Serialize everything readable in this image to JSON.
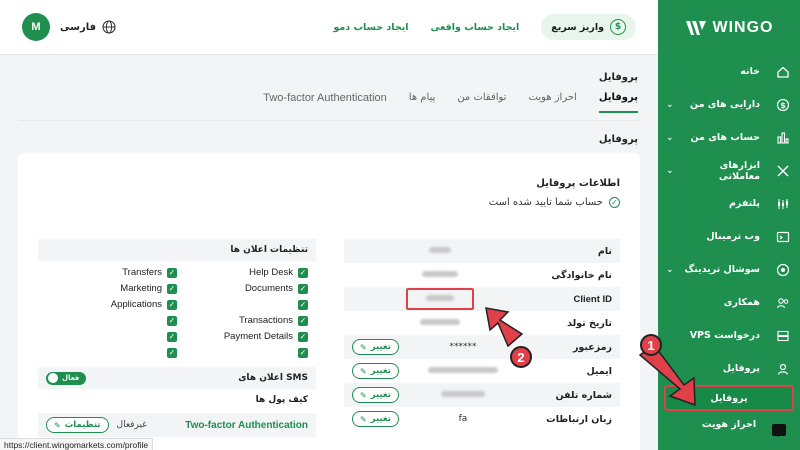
{
  "brand": {
    "name": "WINGO"
  },
  "topbar": {
    "avatar_letter": "M",
    "language": "فارسی",
    "demo_account": "ایجاد حساب دمو",
    "real_account": "ایجاد حساب واقعی",
    "quick_deposit": "واریز سریع"
  },
  "sidebar": {
    "items": [
      {
        "label": "خانه",
        "icon": "home-icon",
        "has_chevron": false
      },
      {
        "label": "دارایی های من",
        "icon": "dollar-circle-icon",
        "has_chevron": true
      },
      {
        "label": "حساب های من",
        "icon": "bar-chart-icon",
        "has_chevron": true
      },
      {
        "label": "ابزارهای معاملاتی",
        "icon": "tools-icon",
        "has_chevron": true
      },
      {
        "label": "پلتفرم",
        "icon": "candles-icon",
        "has_chevron": false
      },
      {
        "label": "وب ترمینال",
        "icon": "terminal-icon",
        "has_chevron": false
      },
      {
        "label": "سوشال تریدینگ",
        "icon": "social-icon",
        "has_chevron": true
      },
      {
        "label": "همکاری",
        "icon": "users-icon",
        "has_chevron": false
      },
      {
        "label": "درخواست VPS",
        "icon": "server-icon",
        "has_chevron": false
      },
      {
        "label": "پروفایل",
        "icon": "user-icon",
        "has_chevron": true
      }
    ],
    "sub_profile": "پروفایل",
    "sub_kyc": "احراز هویت"
  },
  "page": {
    "title": "پروفایل",
    "tabs": [
      {
        "label": "پروفایل",
        "active": true
      },
      {
        "label": "احراز هویت",
        "active": false
      },
      {
        "label": "توافقات من",
        "active": false
      },
      {
        "label": "پیام ها",
        "active": false
      },
      {
        "label": "Two-factor Authentication",
        "active": false
      }
    ],
    "section_title": "پروفایل"
  },
  "card": {
    "title": "اطلاعات پروفایل",
    "verified_text": "حساب شما تایید شده است"
  },
  "info": {
    "rows": [
      {
        "key": "نام",
        "value": ""
      },
      {
        "key": "نام خانوادگی",
        "value": ""
      },
      {
        "key": "Client ID",
        "value": ""
      },
      {
        "key": "تاریخ تولد",
        "value": ""
      },
      {
        "key": "رمزعبور",
        "value": "******"
      },
      {
        "key": "ایمیل",
        "value": ""
      },
      {
        "key": "شماره تلفن",
        "value": ""
      },
      {
        "key": "زبان ارتباطات",
        "value": "fa"
      }
    ],
    "change_label": "تغییر"
  },
  "notifications": {
    "title": "تنظیمات اعلان ها",
    "col_right": [
      "Help Desk",
      "Documents",
      "",
      "Transactions",
      "Payment Details",
      ""
    ],
    "col_left": [
      "Transfers",
      "Marketing",
      "Applications",
      "",
      "",
      ""
    ],
    "sms_label": "SMS اعلان های",
    "sms_toggle": "فعال",
    "wallet_label": "کیف پول ها",
    "twofa_label": "Two-factor Authentication",
    "twofa_status": "غیرفعال",
    "twofa_button": "تنظیمات"
  },
  "annotations": {
    "badge_1": "1",
    "badge_2": "2"
  },
  "statusbar": {
    "url": "https://client.wingomarkets.com/profile"
  },
  "colors": {
    "brand_green": "#1e8f4f",
    "annotation_red": "#e0404a"
  }
}
